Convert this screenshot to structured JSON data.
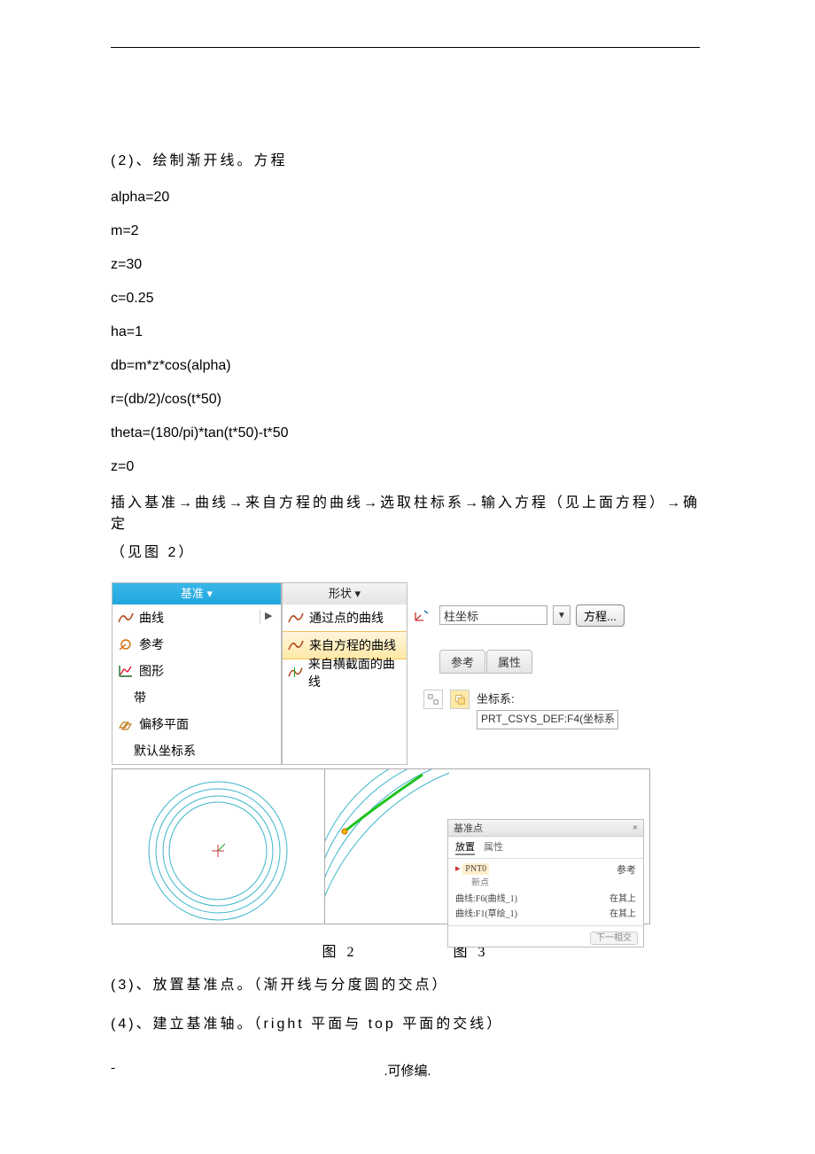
{
  "header_title": "(2)、绘制渐开线。方程",
  "eq": {
    "l1": "alpha=20",
    "l2": "m=2",
    "l3": "z=30",
    "l4": "c=0.25",
    "l5": "ha=1",
    "l6": "db=m*z*cos(alpha)",
    "l7": "r=(db/2)/cos(t*50)",
    "l8": "theta=(180/pi)*tan(t*50)-t*50",
    "l9": "z=0"
  },
  "proc_line1": "插入基准→曲线→来自方程的曲线→选取柱标系→输入方程（见上面方程）→确定",
  "proc_line2": "（见图 2）",
  "leftmenu": {
    "head": "基准 ▾",
    "curve": "曲线",
    "ref": "参考",
    "graph": "图形",
    "band": "带",
    "offsetplane": "偏移平面",
    "defcsys": "默认坐标系"
  },
  "midmenu": {
    "head": "形状 ▾",
    "through": "通过点的曲线",
    "equation": "来自方程的曲线",
    "section": "来自横截面的曲线"
  },
  "ribbon": {
    "coord": "柱坐标",
    "formula": "方程...",
    "tab_ref": "参考",
    "tab_attr": "属性",
    "csys_label": "坐标系:",
    "csys_value": "PRT_CSYS_DEF:F4(坐标系"
  },
  "bp": {
    "title": "基准点",
    "close": "×",
    "tab_place": "放置",
    "tab_attr": "属性",
    "pnt": "PNT0",
    "new": "新点",
    "ref": "参考",
    "row1_l": "曲线:F6(曲线_1)",
    "row1_r": "在其上",
    "row2_l": "曲线:F1(草绘_1)",
    "row2_r": "在其上",
    "next": "下一相交"
  },
  "caps": {
    "fig2": "图 2",
    "fig3": "图 3"
  },
  "step3": "(3)、放置基准点。（渐开线与分度圆的交点）",
  "step4": "(4)、建立基准轴。（right 平面与 top 平面的交线）",
  "footer": {
    "dash": "-",
    "dot": ".",
    "edit": ".可修编."
  }
}
